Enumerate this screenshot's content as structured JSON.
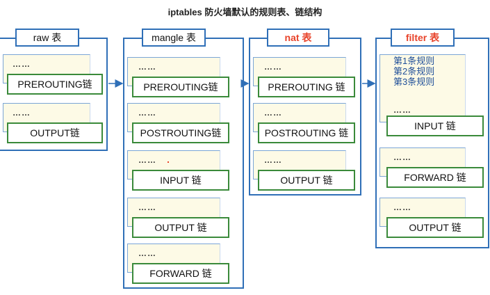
{
  "title": "iptables 防火墙默认的规则表、链结构",
  "colors": {
    "table_border": "#2f6fb7",
    "chain_border": "#3a8a3a",
    "chain_bg": "#fdfae6",
    "highlight": "#e8432a",
    "rule_text": "#1f4f99"
  },
  "tables": [
    {
      "label": "raw 表",
      "chains": [
        {
          "dots": "……",
          "name": "PREROUTING链"
        },
        {
          "dots": "……",
          "name": "OUTPUT链"
        }
      ]
    },
    {
      "label": "mangle 表",
      "chains": [
        {
          "dots": "……",
          "name": "PREROUTING链"
        },
        {
          "dots": "……",
          "name": "POSTROUTING链"
        },
        {
          "dots": "……",
          "name": "INPUT 链"
        },
        {
          "dots": "……",
          "name": "OUTPUT 链"
        },
        {
          "dots": "……",
          "name": "FORWARD 链"
        }
      ]
    },
    {
      "label": "nat 表",
      "chains": [
        {
          "dots": "……",
          "name": "PREROUTING 链"
        },
        {
          "dots": "……",
          "name": "POSTROUTING 链"
        },
        {
          "dots": "……",
          "name": "OUTPUT 链"
        }
      ]
    },
    {
      "label": "filter 表",
      "chains": [
        {
          "rules": [
            "第1条规则",
            "第2条规则",
            "第3条规则"
          ],
          "dots": "……",
          "name": "INPUT 链"
        },
        {
          "dots": "……",
          "name": "FORWARD 链"
        },
        {
          "dots": "……",
          "name": "OUTPUT 链"
        }
      ]
    }
  ]
}
